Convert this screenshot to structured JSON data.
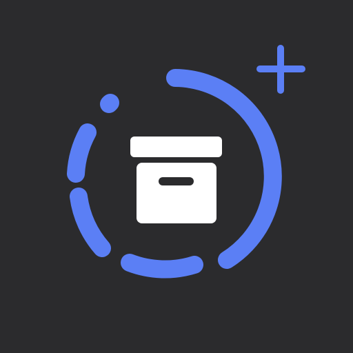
{
  "icon": {
    "name": "archive-box-with-progress-ring-icon",
    "plus_badge": "plus-icon",
    "colors": {
      "background": "#2b2b2d",
      "ring": "#5b7ff5",
      "box": "#ffffff",
      "box_handle": "#2b2b2d"
    },
    "ring_progress": 0.6
  }
}
